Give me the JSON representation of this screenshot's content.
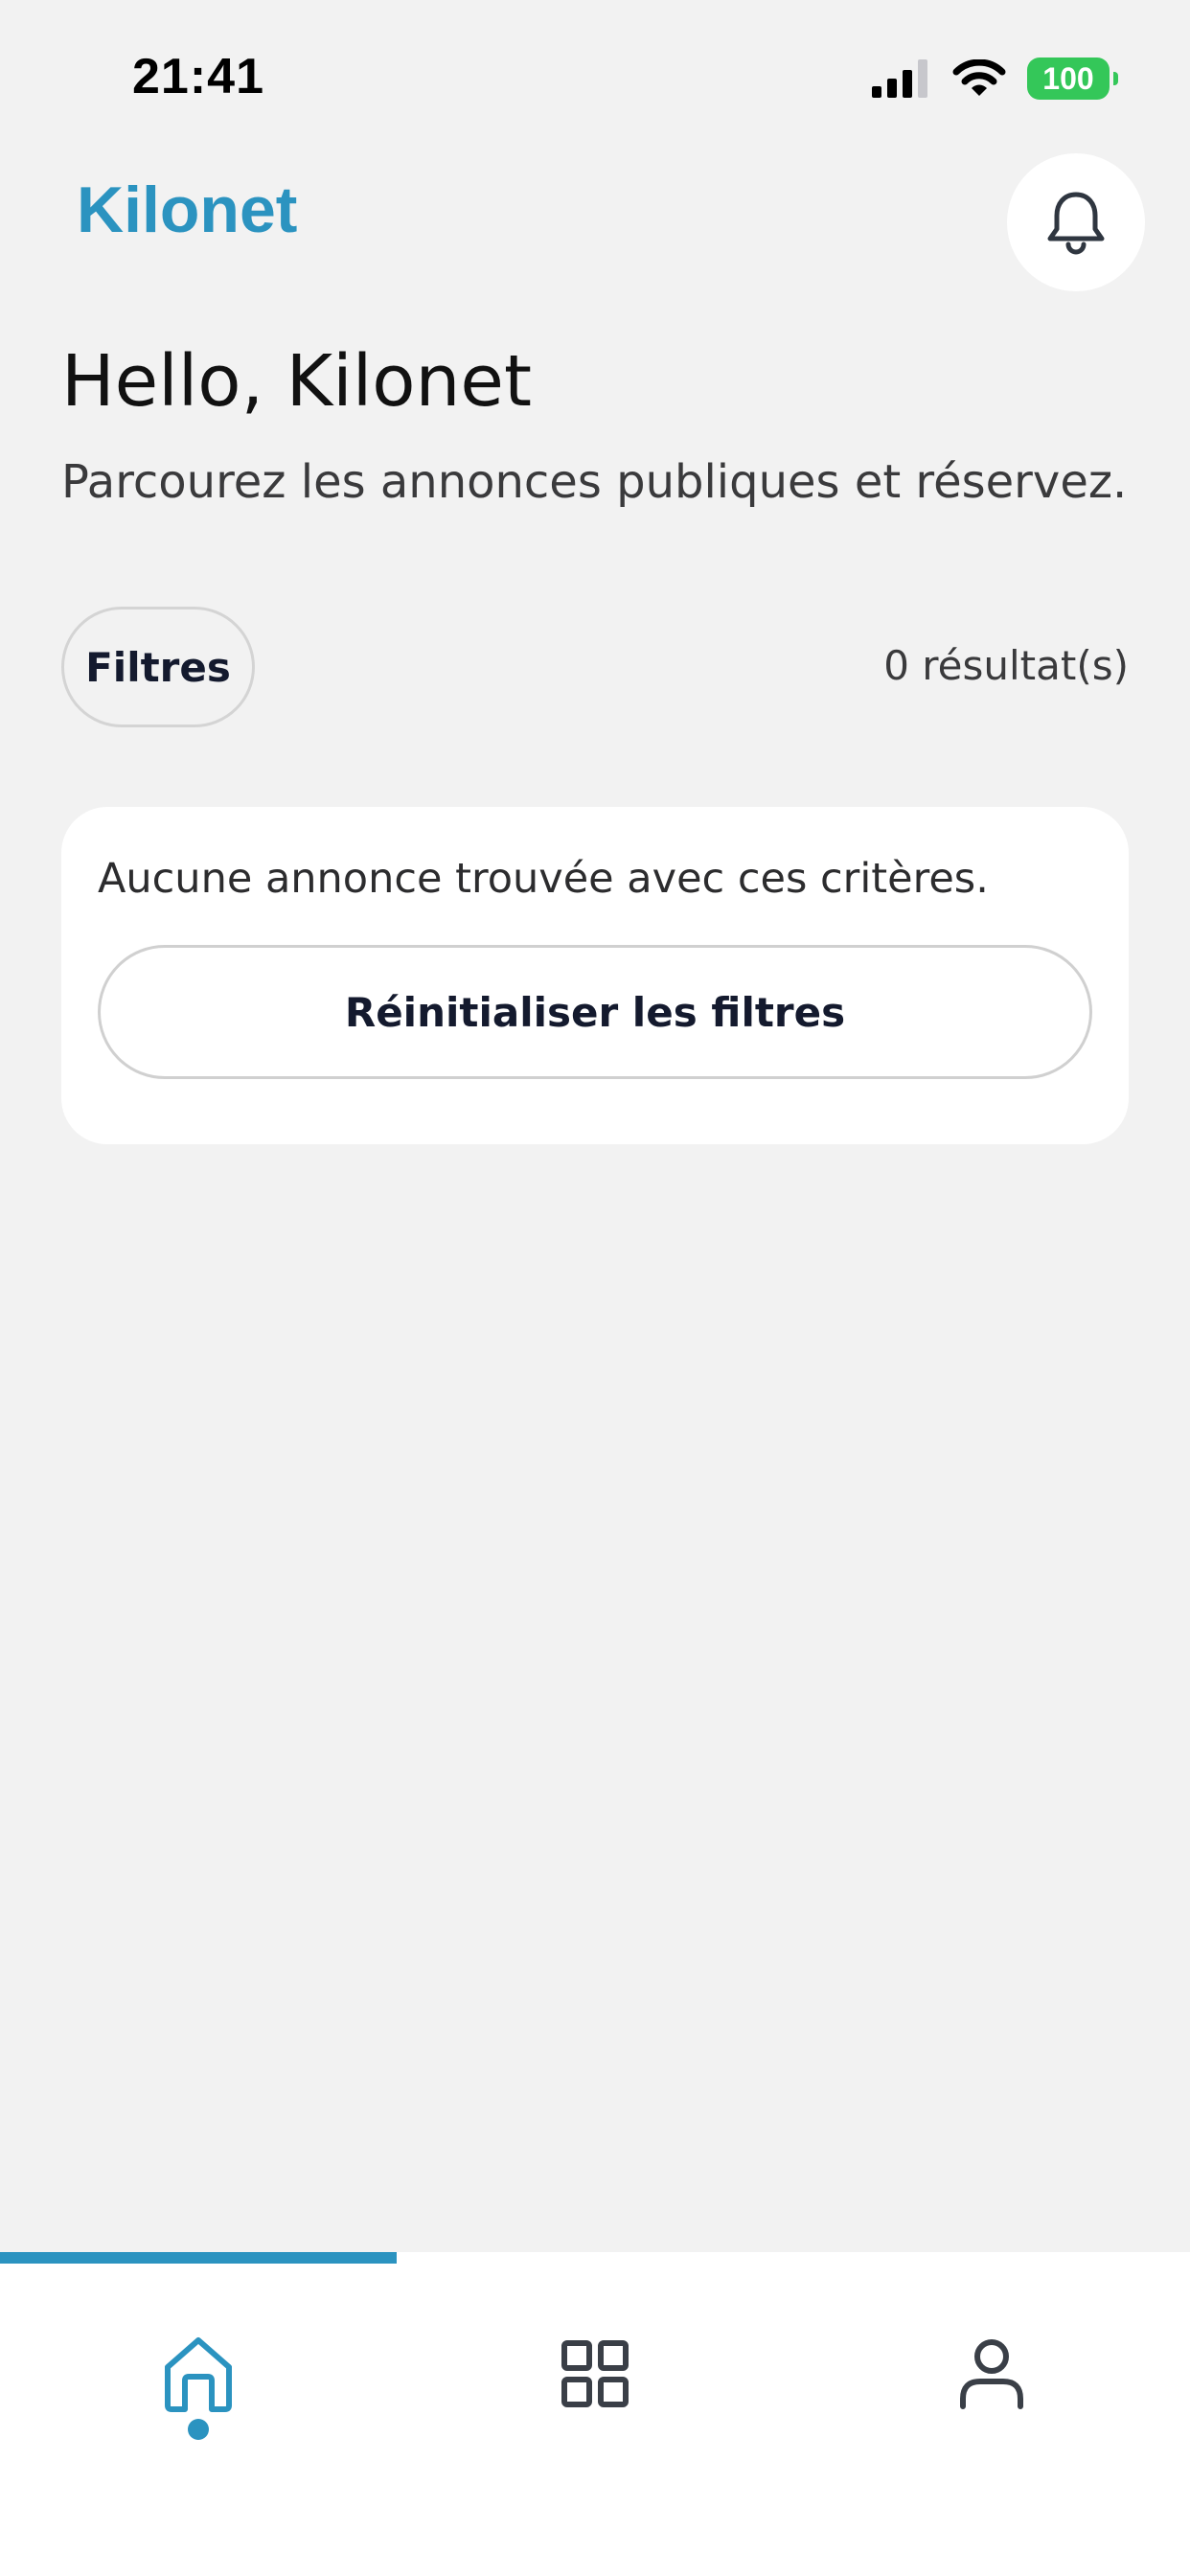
{
  "status_bar": {
    "time": "21:41",
    "battery": "100",
    "icons": [
      "signal-icon",
      "wifi-icon",
      "battery-icon"
    ]
  },
  "header": {
    "brand": "Kilonet",
    "notification_icon": "bell-icon"
  },
  "greeting": {
    "title": "Hello, Kilonet",
    "subtitle": "Parcourez les annonces publiques et réservez."
  },
  "filters": {
    "button_label": "Filtres",
    "result_count": "0 résultat(s)"
  },
  "empty_state": {
    "message": "Aucune annonce trouvée avec ces critères.",
    "reset_label": "Réinitialiser les filtres"
  },
  "tab_bar": {
    "tabs": [
      {
        "id": "home",
        "icon": "home-icon",
        "active": true
      },
      {
        "id": "grid",
        "icon": "grid-icon",
        "active": false
      },
      {
        "id": "profile",
        "icon": "user-icon",
        "active": false
      }
    ]
  },
  "colors": {
    "accent": "#2b93c0",
    "background": "#f2f2f2",
    "card": "#ffffff",
    "battery": "#34c759"
  }
}
